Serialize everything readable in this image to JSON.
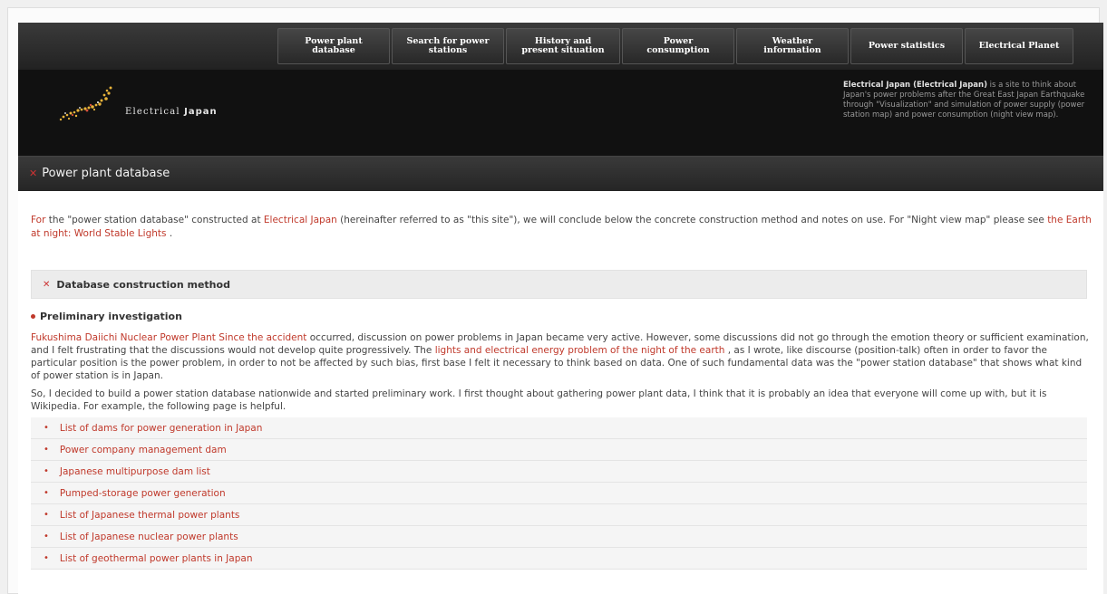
{
  "nav": {
    "items": [
      {
        "label": "Power plant\ndatabase"
      },
      {
        "label": "Search for power\nstations"
      },
      {
        "label": "History and\npresent situation"
      },
      {
        "label": "Power\nconsumption"
      },
      {
        "label": "Weather\ninformation"
      },
      {
        "label": "Power statistics"
      },
      {
        "label": "Electrical Planet"
      }
    ]
  },
  "header": {
    "logo_text_pre": "Electrical ",
    "logo_text_bold": "Japan",
    "desc_bold": "Electrical Japan (Electrical Japan)",
    "desc_rest": " is a site to think about Japan's power problems after the Great East Japan Earthquake through \"Visualization\" and simulation of power supply (power station map) and power consumption (night view map)."
  },
  "section": {
    "title": "Power plant database"
  },
  "intro": {
    "t1": "For",
    "t2": " the \"power station database\" constructed at ",
    "t3": "Electrical Japan",
    "t4": " (hereinafter referred to as \"this site\"), we will conclude below the concrete construction method and notes on use. For \"Night view map\" please see ",
    "t5": "the Earth at night: World Stable Lights",
    "t6": " ."
  },
  "db_section": {
    "title": "Database construction method"
  },
  "prelim": {
    "heading": "Preliminary investigation",
    "p1_link1": "Fukushima Daiichi Nuclear Power Plant Since the accident",
    "p1_text1": " occurred, discussion on power problems in Japan became very active. However, some discussions did not go through the emotion theory or sufficient examination, and I felt frustrating that the discussions would not develop quite progressively. The ",
    "p1_link2": "lights and electrical energy problem of the night of the earth",
    "p1_text2": " , as I wrote, like discourse (position-talk) often in order to favor the particular position is the power problem, in order to not be affected by such bias, first base I felt it necessary to think based on data. One of such fundamental data was the \"power station database\" that shows what kind of power station is in Japan.",
    "p2": "So, I decided to build a power station database nationwide and started preliminary work. I first thought about gathering power plant data, I think that it is probably an idea that everyone will come up with, but it is Wikipedia. For example, the following page is helpful."
  },
  "links": [
    {
      "label": "List of dams for power generation in Japan"
    },
    {
      "label": "Power company management dam"
    },
    {
      "label": "Japanese multipurpose dam list"
    },
    {
      "label": "Pumped-storage power generation"
    },
    {
      "label": "List of Japanese thermal power plants"
    },
    {
      "label": "List of Japanese nuclear power plants"
    },
    {
      "label": "List of geothermal power plants in Japan"
    }
  ],
  "colors": {
    "accent": "#c0392b",
    "nav_bg": "#222222",
    "header_bg": "#111111"
  },
  "icons": {
    "section": "x-mark-icon",
    "logo": "japan-map-dots-icon"
  }
}
